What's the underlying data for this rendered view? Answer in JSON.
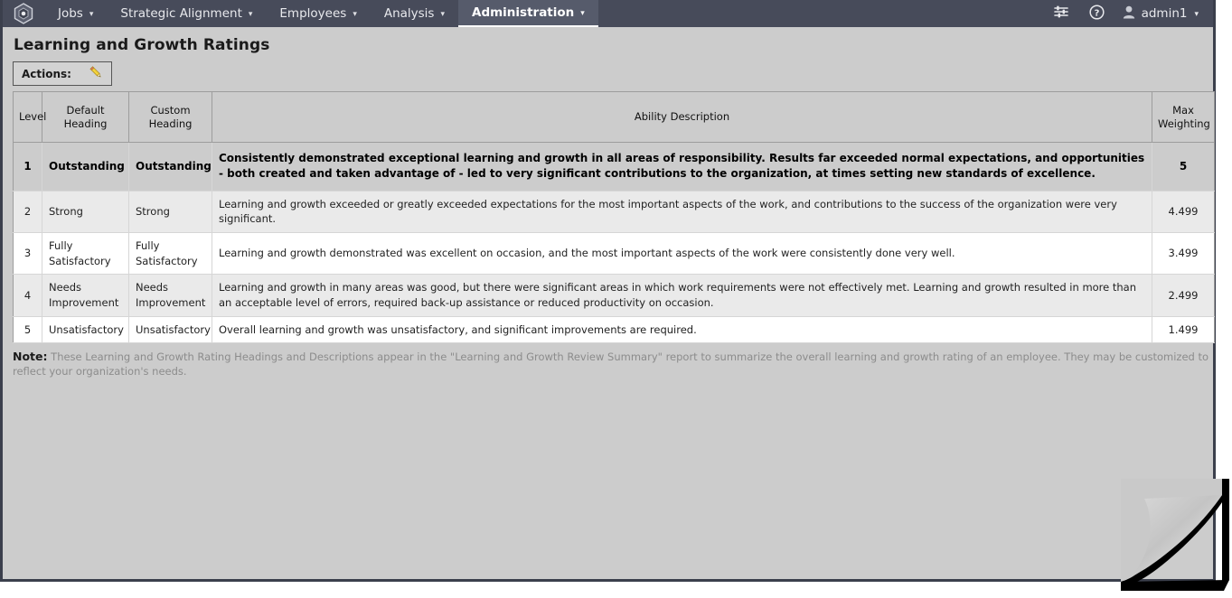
{
  "navbar": {
    "logo_icon": "hexagon-logo-icon",
    "items": [
      {
        "label": "Jobs",
        "caret": "▾",
        "active": false
      },
      {
        "label": "Strategic Alignment",
        "caret": "▾",
        "active": false
      },
      {
        "label": "Employees",
        "caret": "▾",
        "active": false
      },
      {
        "label": "Analysis",
        "caret": "▾",
        "active": false
      },
      {
        "label": "Administration",
        "caret": "▾",
        "active": true
      }
    ],
    "right": {
      "settings_icon": "sliders-icon",
      "help_icon": "help-circle-icon",
      "user_icon": "user-avatar-icon",
      "user_name": "admin1",
      "user_caret": "▾"
    }
  },
  "page": {
    "title": "Learning and Growth Ratings"
  },
  "toolbar": {
    "actions_label": "Actions:",
    "edit_icon": "pencil-edit-icon"
  },
  "table": {
    "columns": [
      "Level",
      "Default Heading",
      "Custom Heading",
      "Ability Description",
      "Max Weighting"
    ],
    "rows": [
      {
        "level": "1",
        "default_heading": "Outstanding",
        "custom_heading": "Outstanding",
        "description": "Consistently demonstrated exceptional learning and growth in all areas of responsibility. Results far exceeded normal expectations, and opportunities - both created and taken advantage of - led to very significant contributions to the organization, at times setting new standards of excellence.",
        "max_weighting": "5"
      },
      {
        "level": "2",
        "default_heading": "Strong",
        "custom_heading": "Strong",
        "description": "Learning and growth exceeded or greatly exceeded expectations for the most important aspects of the work, and contributions to the success of the organization were very significant.",
        "max_weighting": "4.499"
      },
      {
        "level": "3",
        "default_heading": "Fully Satisfactory",
        "custom_heading": "Fully Satisfactory",
        "description": "Learning and growth demonstrated was excellent on occasion, and the most important aspects of the work were consistently done very well.",
        "max_weighting": "3.499"
      },
      {
        "level": "4",
        "default_heading": "Needs Improvement",
        "custom_heading": "Needs Improvement",
        "description": "Learning and growth in many areas was good, but there were significant areas in which work requirements were not effectively met. Learning and growth resulted in more than an acceptable level of errors, required back-up assistance or reduced productivity on occasion.",
        "max_weighting": "2.499"
      },
      {
        "level": "5",
        "default_heading": "Unsatisfactory",
        "custom_heading": "Unsatisfactory",
        "description": "Overall learning and growth was unsatisfactory, and significant improvements are required.",
        "max_weighting": "1.499"
      }
    ]
  },
  "note": {
    "label": "Note:",
    "text": "These Learning and Growth Rating Headings and Descriptions appear in the \"Learning and Growth Review Summary\" report to summarize the overall learning and growth rating of an employee. They may be customized to reflect your organization's needs."
  },
  "colors": {
    "navbar_bg": "#474b5a",
    "navbar_active_bg": "#565b6b",
    "page_bg": "#cccccc",
    "row_shade": "#eaeaea",
    "row_plain": "#ffffff",
    "note_text": "#8c8c8c"
  }
}
